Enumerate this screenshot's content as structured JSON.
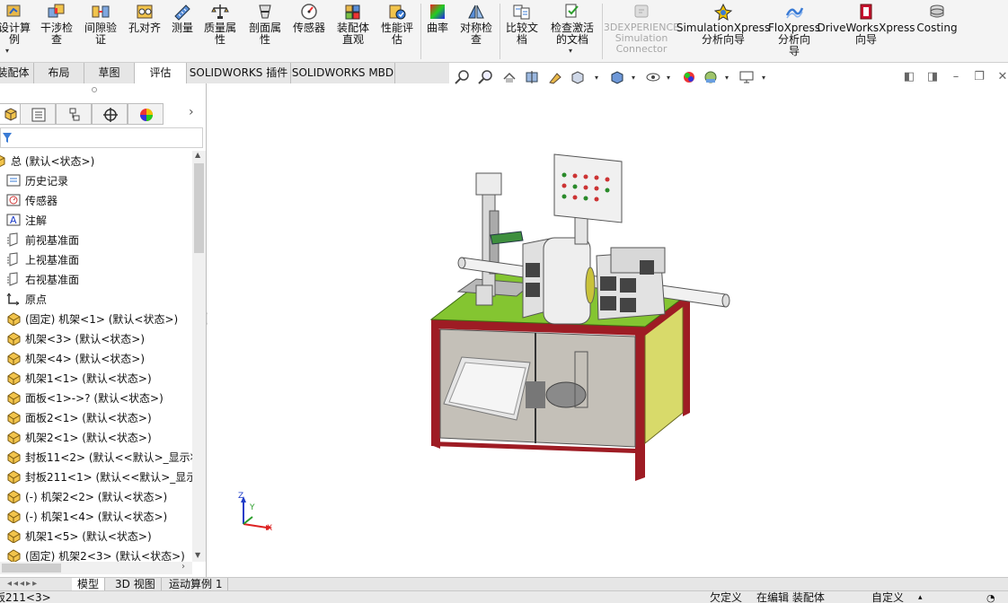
{
  "ribbon": {
    "buttons": [
      {
        "label": "设计算\n例",
        "icon": "design-study-icon"
      },
      {
        "label": "干涉检\n查",
        "icon": "interference-detection-icon"
      },
      {
        "label": "间隙验\n证",
        "icon": "clearance-verification-icon"
      },
      {
        "label": "孔对齐",
        "icon": "hole-alignment-icon"
      },
      {
        "label": "测量",
        "icon": "measure-icon"
      },
      {
        "label": "质量属\n性",
        "icon": "mass-properties-icon"
      },
      {
        "label": "剖面属\n性",
        "icon": "section-properties-icon"
      },
      {
        "label": "传感器",
        "icon": "sensor-icon"
      },
      {
        "label": "装配体\n直观",
        "icon": "assembly-visualization-icon"
      },
      {
        "label": "性能评\n估",
        "icon": "performance-evaluation-icon"
      },
      {
        "label": "曲率",
        "icon": "curvature-icon"
      },
      {
        "label": "对称检\n查",
        "icon": "symmetry-check-icon"
      },
      {
        "label": "比较文\n档",
        "icon": "compare-documents-icon"
      },
      {
        "label": "检查激活\n的文档",
        "icon": "check-active-document-icon"
      },
      {
        "label": "3DEXPERIENCE\nSimulation\nConnector",
        "icon": "3dexperience-icon",
        "disabled": true
      },
      {
        "label": "SimulationXpress\n分析向导",
        "icon": "simulationxpress-icon"
      },
      {
        "label": "FloXpress\n分析向\n导",
        "icon": "floxpress-icon"
      },
      {
        "label": "DriveWorksXpress\n向导",
        "icon": "driveworksxpress-icon"
      },
      {
        "label": "Costing",
        "icon": "costing-icon"
      }
    ]
  },
  "tabs": [
    {
      "label": "装配体"
    },
    {
      "label": "布局"
    },
    {
      "label": "草图"
    },
    {
      "label": "评估",
      "active": true
    },
    {
      "label": "SOLIDWORKS 插件"
    },
    {
      "label": "SOLIDWORKS MBD"
    }
  ],
  "tree": {
    "items": [
      {
        "label": "总 (默认<状态>)",
        "icon": "assembly-icon"
      },
      {
        "label": "历史记录",
        "icon": "history-icon"
      },
      {
        "label": "传感器",
        "icon": "sensor-icon"
      },
      {
        "label": "注解",
        "icon": "annotation-icon"
      },
      {
        "label": "前视基准面",
        "icon": "plane-icon"
      },
      {
        "label": "上视基准面",
        "icon": "plane-icon"
      },
      {
        "label": "右视基准面",
        "icon": "plane-icon"
      },
      {
        "label": "原点",
        "icon": "origin-icon"
      },
      {
        "label": "(固定) 机架<1> (默认<状态>)",
        "icon": "part-icon"
      },
      {
        "label": "机架<3> (默认<状态>)",
        "icon": "part-icon"
      },
      {
        "label": "机架<4> (默认<状态>)",
        "icon": "part-icon"
      },
      {
        "label": "机架1<1> (默认<状态>)",
        "icon": "part-icon"
      },
      {
        "label": "面板<1>->? (默认<状态>)",
        "icon": "part-icon"
      },
      {
        "label": "面板2<1> (默认<状态>)",
        "icon": "part-icon"
      },
      {
        "label": "机架2<1> (默认<状态>)",
        "icon": "part-icon"
      },
      {
        "label": "封板11<2> (默认<<默认>_显示状",
        "icon": "part-icon"
      },
      {
        "label": "封板211<1> (默认<<默认>_显示",
        "icon": "part-icon"
      },
      {
        "label": "(-) 机架2<2> (默认<状态>)",
        "icon": "part-icon"
      },
      {
        "label": "(-) 机架1<4> (默认<状态>)",
        "icon": "part-icon"
      },
      {
        "label": "机架1<5> (默认<状态>)",
        "icon": "part-icon"
      },
      {
        "label": "(固定) 机架2<3> (默认<状态>)",
        "icon": "part-icon"
      }
    ]
  },
  "bottom_tabs": [
    {
      "label": "模型",
      "active": true
    },
    {
      "label": "3D 视图"
    },
    {
      "label": "运动算例 1"
    }
  ],
  "status": {
    "selection": "板211<3>",
    "definition": "欠定义",
    "mode": "在编辑 装配体",
    "units": "自定义"
  },
  "triad": {
    "x": "X",
    "y": "Y",
    "z": "Z"
  },
  "colors": {
    "tabletop": "#84c531",
    "frame": "#9e1c24",
    "panel": "#d8da6a",
    "glass": "#c4c0b8"
  }
}
